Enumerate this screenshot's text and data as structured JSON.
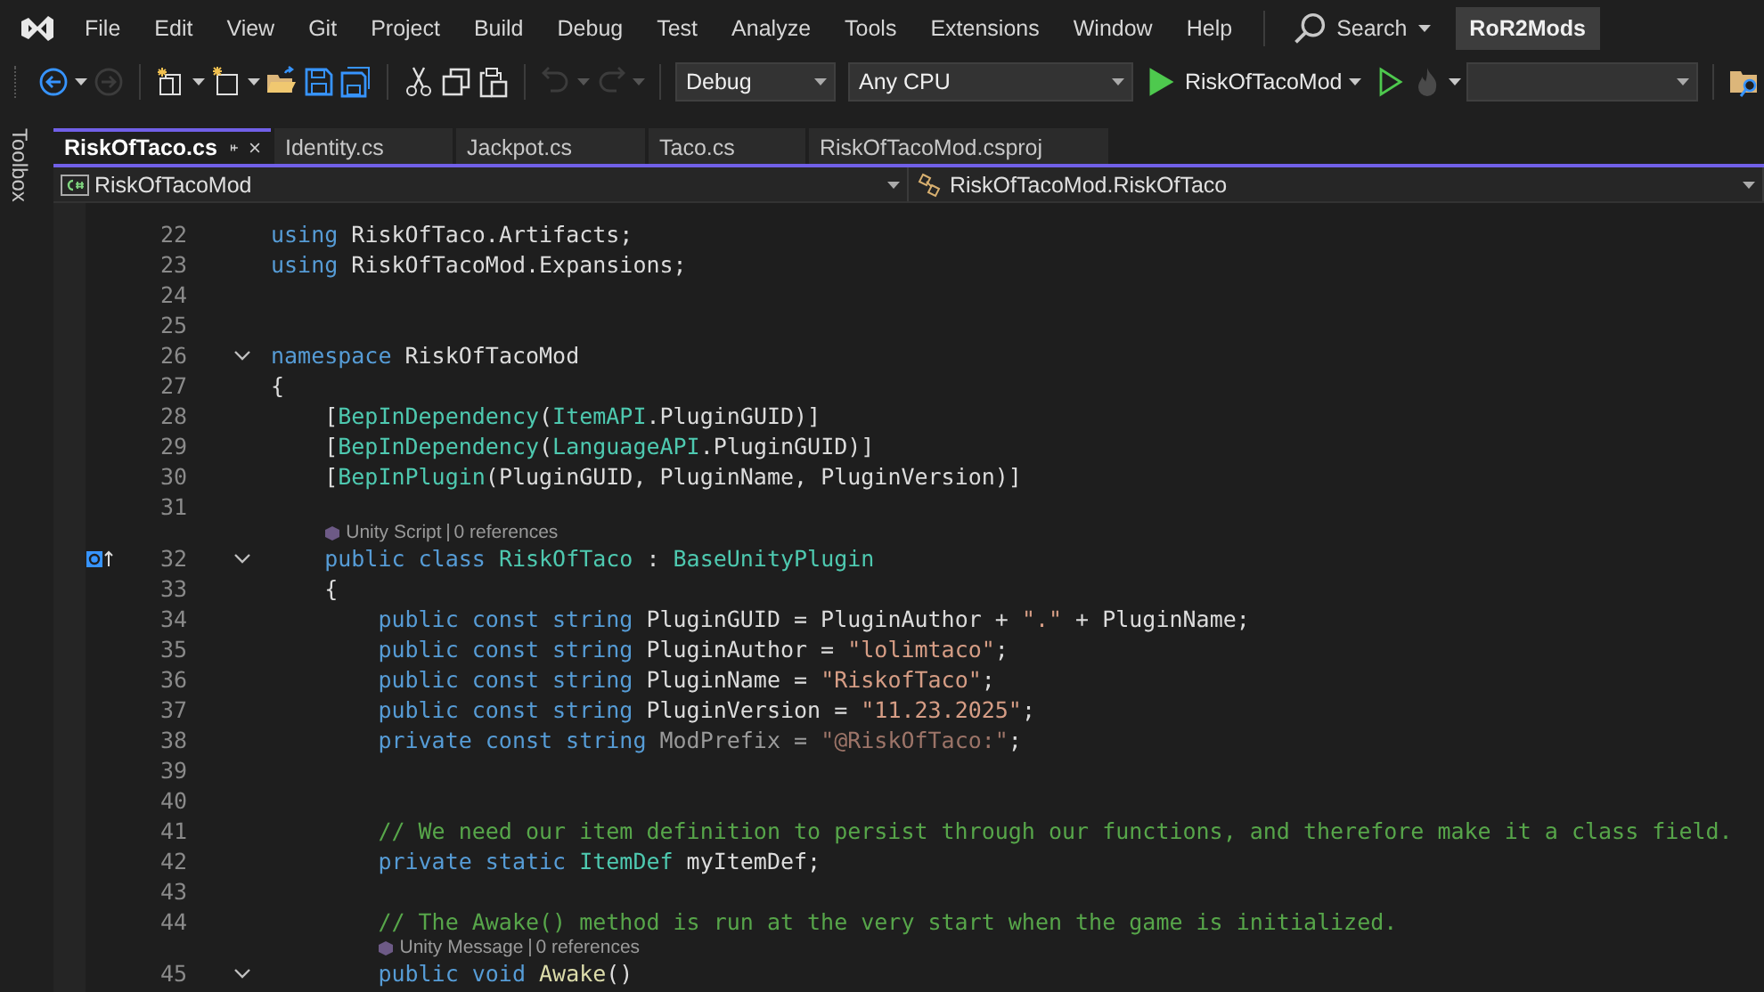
{
  "menu": [
    "File",
    "Edit",
    "View",
    "Git",
    "Project",
    "Build",
    "Debug",
    "Test",
    "Analyze",
    "Tools",
    "Extensions",
    "Window",
    "Help"
  ],
  "search": {
    "label": "Search"
  },
  "solution": "RoR2Mods",
  "toolbar": {
    "buttons": [
      {
        "kind": "back",
        "disabled": false,
        "caret": true
      },
      {
        "kind": "forward",
        "disabled": true,
        "caret": false
      },
      {
        "kind": "sep"
      },
      {
        "kind": "new-project",
        "disabled": false,
        "caret": true
      },
      {
        "kind": "new-file",
        "disabled": false,
        "caret": true
      },
      {
        "kind": "open",
        "disabled": false,
        "caret": false
      },
      {
        "kind": "save",
        "disabled": false,
        "caret": false
      },
      {
        "kind": "save-all",
        "disabled": false,
        "caret": false
      },
      {
        "kind": "sep"
      },
      {
        "kind": "cut",
        "disabled": false,
        "caret": false
      },
      {
        "kind": "copy",
        "disabled": false,
        "caret": false
      },
      {
        "kind": "paste",
        "disabled": false,
        "caret": false
      },
      {
        "kind": "sep"
      },
      {
        "kind": "undo",
        "disabled": true,
        "caret": true
      },
      {
        "kind": "redo",
        "disabled": true,
        "caret": true
      },
      {
        "kind": "sep"
      }
    ],
    "configuration": "Debug",
    "platform": "Any CPU",
    "startup": "RiskOfTacoMod"
  },
  "toolbox": "Toolbox",
  "tabs": [
    {
      "label": "RiskOfTaco.cs",
      "selected": true
    },
    {
      "label": "Identity.cs",
      "selected": false
    },
    {
      "label": "Jackpot.cs",
      "selected": false
    },
    {
      "label": "Taco.cs",
      "selected": false
    },
    {
      "label": "RiskOfTacoMod.csproj",
      "selected": false
    }
  ],
  "nav": {
    "project": "RiskOfTacoMod",
    "type": "RiskOfTacoMod.RiskOfTaco"
  },
  "lines": [
    {
      "kind": "code",
      "number": "22",
      "tokens": [
        {
          "kind": "kw",
          "text": "using"
        },
        {
          "kind": "plain",
          "text": " RiskOfTaco.Artifacts;"
        }
      ]
    },
    {
      "kind": "code",
      "number": "23",
      "tokens": [
        {
          "kind": "kw",
          "text": "using"
        },
        {
          "kind": "plain",
          "text": " RiskOfTacoMod.Expansions;"
        }
      ]
    },
    {
      "kind": "code",
      "number": "24"
    },
    {
      "kind": "code",
      "number": "25"
    },
    {
      "kind": "code",
      "number": "26",
      "fold": true,
      "tokens": [
        {
          "kind": "kw",
          "text": "namespace"
        },
        {
          "kind": "plain",
          "text": " RiskOfTacoMod"
        }
      ]
    },
    {
      "kind": "code",
      "number": "27",
      "tokens": [
        {
          "kind": "plain",
          "text": "{"
        }
      ]
    },
    {
      "kind": "code",
      "number": "28",
      "tokens": [
        {
          "kind": "plain",
          "text": "    ["
        },
        {
          "kind": "type",
          "text": "BepInDependency"
        },
        {
          "kind": "plain",
          "text": "("
        },
        {
          "kind": "type",
          "text": "ItemAPI"
        },
        {
          "kind": "plain",
          "text": ".PluginGUID)]"
        }
      ]
    },
    {
      "kind": "code",
      "number": "29",
      "tokens": [
        {
          "kind": "plain",
          "text": "    ["
        },
        {
          "kind": "type",
          "text": "BepInDependency"
        },
        {
          "kind": "plain",
          "text": "("
        },
        {
          "kind": "type",
          "text": "LanguageAPI"
        },
        {
          "kind": "plain",
          "text": ".PluginGUID)]"
        }
      ]
    },
    {
      "kind": "code",
      "number": "30",
      "tokens": [
        {
          "kind": "plain",
          "text": "    ["
        },
        {
          "kind": "type",
          "text": "BepInPlugin"
        },
        {
          "kind": "plain",
          "text": "(PluginGUID, PluginName, PluginVersion)]"
        }
      ]
    },
    {
      "kind": "code",
      "number": "31"
    },
    {
      "kind": "lens",
      "label": "Unity Script",
      "refs": "0 references"
    },
    {
      "kind": "code",
      "number": "32",
      "fold": true,
      "marker": true,
      "tokens": [
        {
          "kind": "kw",
          "text": "    public class "
        },
        {
          "kind": "type",
          "text": "RiskOfTaco"
        },
        {
          "kind": "plain",
          "text": " : "
        },
        {
          "kind": "type",
          "text": "BaseUnityPlugin"
        }
      ]
    },
    {
      "kind": "code",
      "number": "33",
      "tokens": [
        {
          "kind": "plain",
          "text": "    {"
        }
      ]
    },
    {
      "kind": "code",
      "number": "34",
      "tokens": [
        {
          "kind": "kw",
          "text": "        public const string"
        },
        {
          "kind": "plain",
          "text": " PluginGUID = PluginAuthor + "
        },
        {
          "kind": "str",
          "text": "\".\""
        },
        {
          "kind": "plain",
          "text": " + PluginName;"
        }
      ]
    },
    {
      "kind": "code",
      "number": "35",
      "tokens": [
        {
          "kind": "kw",
          "text": "        public const string"
        },
        {
          "kind": "plain",
          "text": " PluginAuthor = "
        },
        {
          "kind": "str",
          "text": "\"lolimtaco\""
        },
        {
          "kind": "plain",
          "text": ";"
        }
      ]
    },
    {
      "kind": "code",
      "number": "36",
      "tokens": [
        {
          "kind": "kw",
          "text": "        public const string"
        },
        {
          "kind": "plain",
          "text": " PluginName = "
        },
        {
          "kind": "str",
          "text": "\"RiskofTaco\""
        },
        {
          "kind": "plain",
          "text": ";"
        }
      ]
    },
    {
      "kind": "code",
      "number": "37",
      "tokens": [
        {
          "kind": "kw",
          "text": "        public const string"
        },
        {
          "kind": "plain",
          "text": " PluginVersion = "
        },
        {
          "kind": "str",
          "text": "\"11.23.2025\""
        },
        {
          "kind": "plain",
          "text": ";"
        }
      ]
    },
    {
      "kind": "code",
      "number": "38",
      "tokens": [
        {
          "kind": "kw",
          "text": "        private const string"
        },
        {
          "kind": "faded",
          "text": " ModPrefix = "
        },
        {
          "kind": "faded-str",
          "text": "\"@RiskOfTaco:\""
        },
        {
          "kind": "plain",
          "text": ";"
        }
      ]
    },
    {
      "kind": "code",
      "number": "39"
    },
    {
      "kind": "code",
      "number": "40"
    },
    {
      "kind": "code",
      "number": "41",
      "tokens": [
        {
          "kind": "comment",
          "text": "        // We need our item definition to persist through our functions, and therefore make it a class field."
        }
      ]
    },
    {
      "kind": "code",
      "number": "42",
      "tokens": [
        {
          "kind": "kw",
          "text": "        private static "
        },
        {
          "kind": "type",
          "text": "ItemDef"
        },
        {
          "kind": "plain",
          "text": " myItemDef;"
        }
      ]
    },
    {
      "kind": "code",
      "number": "43"
    },
    {
      "kind": "code",
      "number": "44",
      "tokens": [
        {
          "kind": "comment",
          "text": "        // The Awake() method is run at the very start when the game is initialized."
        }
      ]
    },
    {
      "kind": "lens",
      "label": "Unity Message",
      "refs": "0 references"
    },
    {
      "kind": "code",
      "number": "45",
      "fold": true,
      "tokens": [
        {
          "kind": "kw",
          "text": "        public void "
        },
        {
          "kind": "method",
          "text": "Awake"
        },
        {
          "kind": "plain",
          "text": "()"
        }
      ]
    }
  ]
}
